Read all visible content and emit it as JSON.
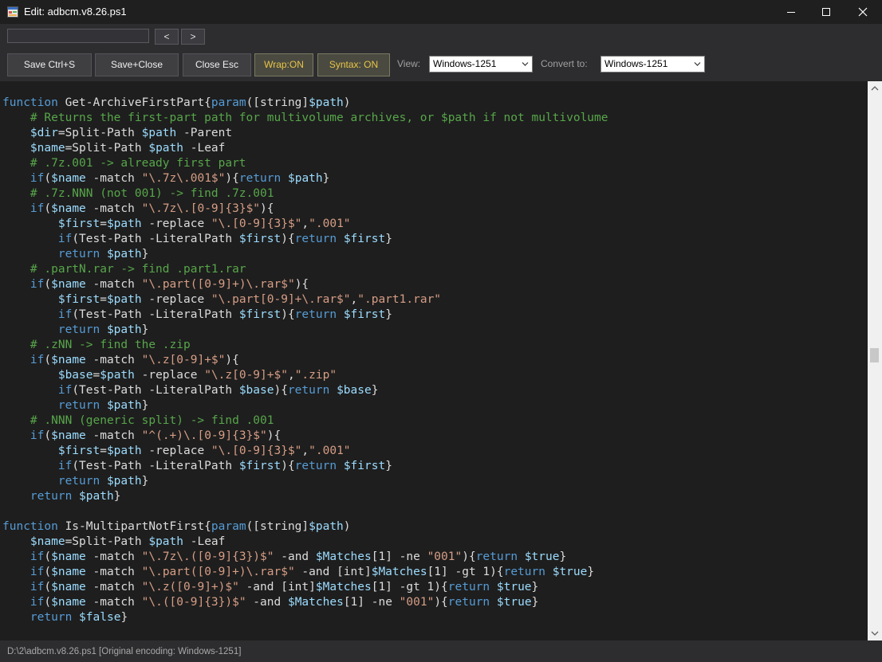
{
  "window": {
    "title": "Edit: adbcm.v8.26.ps1",
    "icon": "app-window-icon",
    "controls": [
      "minimize-icon",
      "maximize-icon",
      "close-icon"
    ]
  },
  "search": {
    "value": "",
    "prev_label": "<",
    "next_label": ">"
  },
  "toolbar": {
    "save_label": "Save Ctrl+S",
    "save_close_label": "Save+Close",
    "close_label": "Close Esc",
    "wrap_label": "Wrap:ON",
    "syntax_label": "Syntax: ON",
    "view_label": "View:",
    "view_value": "Windows-1251",
    "convert_label": "Convert to:",
    "convert_value": "Windows-1251"
  },
  "colors": {
    "keyword": "#569cd6",
    "variable": "#9cdcfe",
    "string": "#d69d85",
    "comment": "#57a64a",
    "text": "#dcdcdc",
    "editor_bg": "#1e1e1e",
    "toggle_text": "#e8c547"
  },
  "editor": {
    "lines": [
      [
        [
          "kw",
          "function"
        ],
        [
          "t",
          " Get-ArchiveFirstPart{"
        ],
        [
          "kw",
          "param"
        ],
        [
          "t",
          "([string]"
        ],
        [
          "var",
          "$path"
        ],
        [
          "t",
          ")"
        ]
      ],
      [
        [
          "cm",
          "    # Returns the first-part path for multivolume archives, or $path if not multivolume"
        ]
      ],
      [
        [
          "var",
          "    $dir"
        ],
        [
          "t",
          "=Split-Path "
        ],
        [
          "var",
          "$path"
        ],
        [
          "t",
          " -Parent"
        ]
      ],
      [
        [
          "var",
          "    $name"
        ],
        [
          "t",
          "=Split-Path "
        ],
        [
          "var",
          "$path"
        ],
        [
          "t",
          " -Leaf"
        ]
      ],
      [
        [
          "cm",
          "    # .7z.001 -> already first part"
        ]
      ],
      [
        [
          "kw",
          "    if"
        ],
        [
          "t",
          "("
        ],
        [
          "var",
          "$name"
        ],
        [
          "t",
          " -match "
        ],
        [
          "str",
          "\"\\.7z\\.001$\""
        ],
        [
          "t",
          "){"
        ],
        [
          "kw",
          "return"
        ],
        [
          "t",
          " "
        ],
        [
          "var",
          "$path"
        ],
        [
          "t",
          "}"
        ]
      ],
      [
        [
          "cm",
          "    # .7z.NNN (not 001) -> find .7z.001"
        ]
      ],
      [
        [
          "kw",
          "    if"
        ],
        [
          "t",
          "("
        ],
        [
          "var",
          "$name"
        ],
        [
          "t",
          " -match "
        ],
        [
          "str",
          "\"\\.7z\\.[0-9]{3}$\""
        ],
        [
          "t",
          "){"
        ]
      ],
      [
        [
          "var",
          "        $first"
        ],
        [
          "t",
          "="
        ],
        [
          "var",
          "$path"
        ],
        [
          "t",
          " -replace "
        ],
        [
          "str",
          "\"\\.[0-9]{3}$\""
        ],
        [
          "t",
          ","
        ],
        [
          "str",
          "\".001\""
        ]
      ],
      [
        [
          "kw",
          "        if"
        ],
        [
          "t",
          "(Test-Path -LiteralPath "
        ],
        [
          "var",
          "$first"
        ],
        [
          "t",
          "){"
        ],
        [
          "kw",
          "return"
        ],
        [
          "t",
          " "
        ],
        [
          "var",
          "$first"
        ],
        [
          "t",
          "}"
        ]
      ],
      [
        [
          "kw",
          "        return"
        ],
        [
          "t",
          " "
        ],
        [
          "var",
          "$path"
        ],
        [
          "t",
          "}"
        ]
      ],
      [
        [
          "cm",
          "    # .partN.rar -> find .part1.rar"
        ]
      ],
      [
        [
          "kw",
          "    if"
        ],
        [
          "t",
          "("
        ],
        [
          "var",
          "$name"
        ],
        [
          "t",
          " -match "
        ],
        [
          "str",
          "\"\\.part([0-9]+)\\.rar$\""
        ],
        [
          "t",
          "){"
        ]
      ],
      [
        [
          "var",
          "        $first"
        ],
        [
          "t",
          "="
        ],
        [
          "var",
          "$path"
        ],
        [
          "t",
          " -replace "
        ],
        [
          "str",
          "\"\\.part[0-9]+\\.rar$\""
        ],
        [
          "t",
          ","
        ],
        [
          "str",
          "\".part1.rar\""
        ]
      ],
      [
        [
          "kw",
          "        if"
        ],
        [
          "t",
          "(Test-Path -LiteralPath "
        ],
        [
          "var",
          "$first"
        ],
        [
          "t",
          "){"
        ],
        [
          "kw",
          "return"
        ],
        [
          "t",
          " "
        ],
        [
          "var",
          "$first"
        ],
        [
          "t",
          "}"
        ]
      ],
      [
        [
          "kw",
          "        return"
        ],
        [
          "t",
          " "
        ],
        [
          "var",
          "$path"
        ],
        [
          "t",
          "}"
        ]
      ],
      [
        [
          "cm",
          "    # .zNN -> find the .zip"
        ]
      ],
      [
        [
          "kw",
          "    if"
        ],
        [
          "t",
          "("
        ],
        [
          "var",
          "$name"
        ],
        [
          "t",
          " -match "
        ],
        [
          "str",
          "\"\\.z[0-9]+$\""
        ],
        [
          "t",
          "){"
        ]
      ],
      [
        [
          "var",
          "        $base"
        ],
        [
          "t",
          "="
        ],
        [
          "var",
          "$path"
        ],
        [
          "t",
          " -replace "
        ],
        [
          "str",
          "\"\\.z[0-9]+$\""
        ],
        [
          "t",
          ","
        ],
        [
          "str",
          "\".zip\""
        ]
      ],
      [
        [
          "kw",
          "        if"
        ],
        [
          "t",
          "(Test-Path -LiteralPath "
        ],
        [
          "var",
          "$base"
        ],
        [
          "t",
          "){"
        ],
        [
          "kw",
          "return"
        ],
        [
          "t",
          " "
        ],
        [
          "var",
          "$base"
        ],
        [
          "t",
          "}"
        ]
      ],
      [
        [
          "kw",
          "        return"
        ],
        [
          "t",
          " "
        ],
        [
          "var",
          "$path"
        ],
        [
          "t",
          "}"
        ]
      ],
      [
        [
          "cm",
          "    # .NNN (generic split) -> find .001"
        ]
      ],
      [
        [
          "kw",
          "    if"
        ],
        [
          "t",
          "("
        ],
        [
          "var",
          "$name"
        ],
        [
          "t",
          " -match "
        ],
        [
          "str",
          "\"^(.+)\\.[0-9]{3}$\""
        ],
        [
          "t",
          "){"
        ]
      ],
      [
        [
          "var",
          "        $first"
        ],
        [
          "t",
          "="
        ],
        [
          "var",
          "$path"
        ],
        [
          "t",
          " -replace "
        ],
        [
          "str",
          "\"\\.[0-9]{3}$\""
        ],
        [
          "t",
          ","
        ],
        [
          "str",
          "\".001\""
        ]
      ],
      [
        [
          "kw",
          "        if"
        ],
        [
          "t",
          "(Test-Path -LiteralPath "
        ],
        [
          "var",
          "$first"
        ],
        [
          "t",
          "){"
        ],
        [
          "kw",
          "return"
        ],
        [
          "t",
          " "
        ],
        [
          "var",
          "$first"
        ],
        [
          "t",
          "}"
        ]
      ],
      [
        [
          "kw",
          "        return"
        ],
        [
          "t",
          " "
        ],
        [
          "var",
          "$path"
        ],
        [
          "t",
          "}"
        ]
      ],
      [
        [
          "kw",
          "    return"
        ],
        [
          "t",
          " "
        ],
        [
          "var",
          "$path"
        ],
        [
          "t",
          "}"
        ]
      ],
      [],
      [
        [
          "kw",
          "function"
        ],
        [
          "t",
          " Is-MultipartNotFirst{"
        ],
        [
          "kw",
          "param"
        ],
        [
          "t",
          "([string]"
        ],
        [
          "var",
          "$path"
        ],
        [
          "t",
          ")"
        ]
      ],
      [
        [
          "var",
          "    $name"
        ],
        [
          "t",
          "=Split-Path "
        ],
        [
          "var",
          "$path"
        ],
        [
          "t",
          " -Leaf"
        ]
      ],
      [
        [
          "kw",
          "    if"
        ],
        [
          "t",
          "("
        ],
        [
          "var",
          "$name"
        ],
        [
          "t",
          " -match "
        ],
        [
          "str",
          "\"\\.7z\\.([0-9]{3})$\""
        ],
        [
          "t",
          " -and "
        ],
        [
          "var",
          "$Matches"
        ],
        [
          "t",
          "[1] -ne "
        ],
        [
          "str",
          "\"001\""
        ],
        [
          "t",
          "){"
        ],
        [
          "kw",
          "return"
        ],
        [
          "t",
          " "
        ],
        [
          "var",
          "$true"
        ],
        [
          "t",
          "}"
        ]
      ],
      [
        [
          "kw",
          "    if"
        ],
        [
          "t",
          "("
        ],
        [
          "var",
          "$name"
        ],
        [
          "t",
          " -match "
        ],
        [
          "str",
          "\"\\.part([0-9]+)\\.rar$\""
        ],
        [
          "t",
          " -and [int]"
        ],
        [
          "var",
          "$Matches"
        ],
        [
          "t",
          "[1] -gt 1){"
        ],
        [
          "kw",
          "return"
        ],
        [
          "t",
          " "
        ],
        [
          "var",
          "$true"
        ],
        [
          "t",
          "}"
        ]
      ],
      [
        [
          "kw",
          "    if"
        ],
        [
          "t",
          "("
        ],
        [
          "var",
          "$name"
        ],
        [
          "t",
          " -match "
        ],
        [
          "str",
          "\"\\.z([0-9]+)$\""
        ],
        [
          "t",
          " -and [int]"
        ],
        [
          "var",
          "$Matches"
        ],
        [
          "t",
          "[1] -gt 1){"
        ],
        [
          "kw",
          "return"
        ],
        [
          "t",
          " "
        ],
        [
          "var",
          "$true"
        ],
        [
          "t",
          "}"
        ]
      ],
      [
        [
          "kw",
          "    if"
        ],
        [
          "t",
          "("
        ],
        [
          "var",
          "$name"
        ],
        [
          "t",
          " -match "
        ],
        [
          "str",
          "\"\\.([0-9]{3})$\""
        ],
        [
          "t",
          " -and "
        ],
        [
          "var",
          "$Matches"
        ],
        [
          "t",
          "[1] -ne "
        ],
        [
          "str",
          "\"001\""
        ],
        [
          "t",
          "){"
        ],
        [
          "kw",
          "return"
        ],
        [
          "t",
          " "
        ],
        [
          "var",
          "$true"
        ],
        [
          "t",
          "}"
        ]
      ],
      [
        [
          "kw",
          "    return"
        ],
        [
          "t",
          " "
        ],
        [
          "var",
          "$false"
        ],
        [
          "t",
          "}"
        ]
      ]
    ]
  },
  "status": {
    "text": "D:\\2\\adbcm.v8.26.ps1  [Original encoding: Windows-1251]"
  }
}
